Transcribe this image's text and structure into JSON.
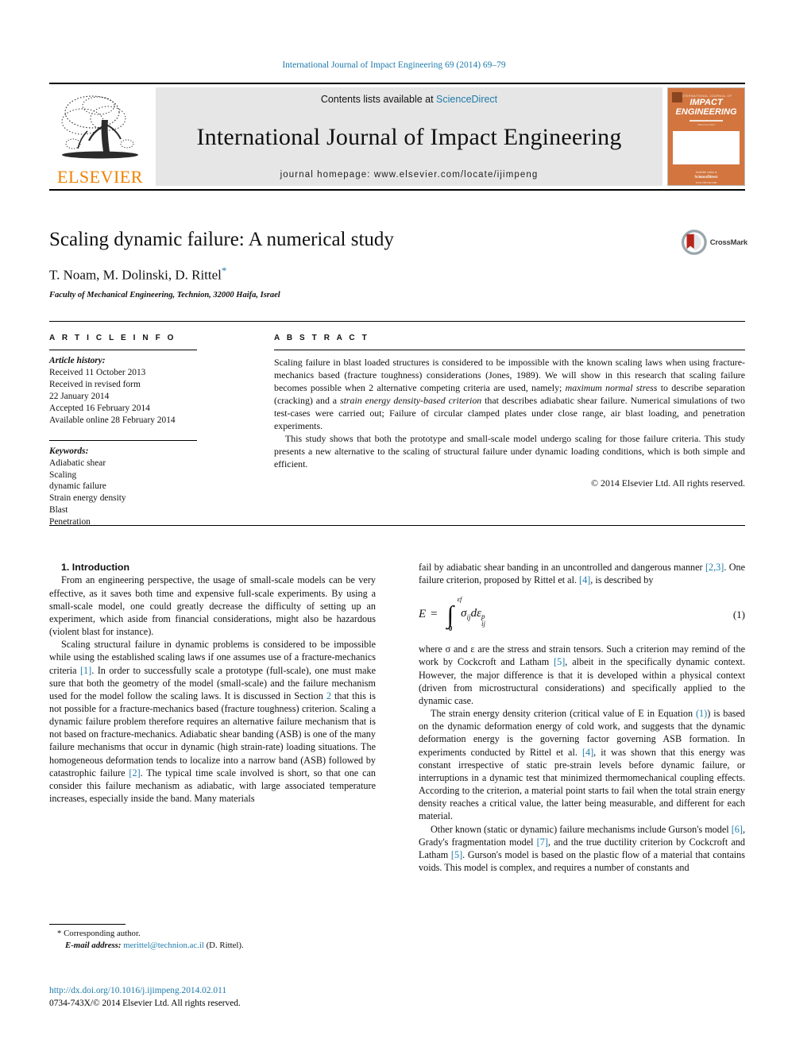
{
  "running_head": "International Journal of Impact Engineering 69 (2014) 69–79",
  "masthead": {
    "publisher": "ELSEVIER",
    "contents_prefix": "Contents lists available at ",
    "contents_link": "ScienceDirect",
    "journal_name": "International Journal of Impact Engineering",
    "homepage": "journal homepage: www.elsevier.com/locate/ijimpeng",
    "cover": {
      "publisher_line": "INTERNATIONAL JOURNAL OF",
      "title_line1": "IMPACT",
      "title_line2": "ENGINEERING",
      "subtitle": "Editor-in-Chief",
      "foot_line1": "Available online at",
      "foot_line2": "ScienceDirect",
      "foot_line3": "www.elsevier.com"
    }
  },
  "article": {
    "title": "Scaling dynamic failure: A numerical study",
    "authors": "T. Noam, M. Dolinski, D. Rittel",
    "corresponding_marker": "*",
    "affiliation": "Faculty of Mechanical Engineering, Technion, 32000 Haifa, Israel",
    "crossmark_label": "CrossMark"
  },
  "article_info": {
    "heading": "A R T I C L E   I N F O",
    "history_label": "Article history:",
    "history": [
      "Received 11 October 2013",
      "Received in revised form",
      "22 January 2014",
      "Accepted 16 February 2014",
      "Available online 28 February 2014"
    ],
    "keywords_label": "Keywords:",
    "keywords": [
      "Adiabatic shear",
      "Scaling",
      "dynamic failure",
      "Strain energy density",
      "Blast",
      "Penetration"
    ]
  },
  "abstract": {
    "heading": "A B S T R A C T",
    "paragraph1_a": "Scaling failure in blast loaded structures is considered to be impossible with the known scaling laws when using fracture-mechanics based (fracture toughness) considerations (Jones, 1989). We will show in this research that scaling failure becomes possible when 2 alternative competing criteria are used, namely; ",
    "paragraph1_i1": "maximum normal stress",
    "paragraph1_b": " to describe separation (cracking) and a ",
    "paragraph1_i2": "strain energy density-based criterion",
    "paragraph1_c": " that describes adiabatic shear failure. Numerical simulations of two test-cases were carried out; Failure of circular clamped plates under close range, air blast loading, and penetration experiments.",
    "paragraph2": "This study shows that both the prototype and small-scale model undergo scaling for those failure criteria. This study presents a new alternative to the scaling of structural failure under dynamic loading conditions, which is both simple and efficient.",
    "copyright": "© 2014 Elsevier Ltd. All rights reserved."
  },
  "body": {
    "section_title": "1. Introduction",
    "left": {
      "p1": "From an engineering perspective, the usage of small-scale models can be very effective, as it saves both time and expensive full-scale experiments. By using a small-scale model, one could greatly decrease the difficulty of setting up an experiment, which aside from financial considerations, might also be hazardous (violent blast for instance).",
      "p2_a": "Scaling structural failure in dynamic problems is considered to be impossible while using the established scaling laws if one assumes use of a fracture-mechanics criteria ",
      "p2_ref1": "[1]",
      "p2_b": ". In order to successfully scale a prototype (full-scale), one must make sure that both the geometry of the model (small-scale) and the failure mechanism used for the model follow the scaling laws. It is discussed in Section ",
      "p2_ref2": "2",
      "p2_c": " that this is not possible for a fracture-mechanics based (fracture toughness) criterion. Scaling a dynamic failure problem therefore requires an alternative failure mechanism that is not based on fracture-mechanics. Adiabatic shear banding (ASB) is one of the many failure mechanisms that occur in dynamic (high strain-rate) loading situations. The homogeneous deformation tends to localize into a narrow band (ASB) followed by catastrophic failure ",
      "p2_ref3": "[2]",
      "p2_d": ". The typical time scale involved is short, so that one can consider this failure mechanism as adiabatic, with large associated temperature increases, especially inside the band. Many materials"
    },
    "right": {
      "p1_a": "fail by adiabatic shear banding in an uncontrolled and dangerous manner ",
      "p1_ref1": "[2,3]",
      "p1_b": ". One failure criterion, proposed by Rittel et al. ",
      "p1_ref2": "[4]",
      "p1_c": ", is described by",
      "equation": {
        "lhs": "E",
        "equals": "=",
        "integral_upper": "εf",
        "integral_lower": "0",
        "integrand_stress": "σ",
        "integrand_stress_sub": "ij",
        "integrand_d": "dε",
        "integrand_sub": "ij",
        "integrand_sup": "p",
        "number": "(1)"
      },
      "p2_a": "where σ and ε are the stress and strain tensors. Such a criterion may remind of the work by Cockcroft and Latham ",
      "p2_ref1": "[5]",
      "p2_b": ", albeit in the specifically dynamic context. However, the major difference is that it is developed within a physical context (driven from microstructural considerations) and specifically applied to the dynamic case.",
      "p3_a": "The strain energy density criterion (critical value of E in Equation ",
      "p3_ref1": "(1)",
      "p3_b": ") is based on the dynamic deformation energy of cold work, and suggests that the dynamic deformation energy is the governing factor governing ASB formation. In experiments conducted by Rittel et al. ",
      "p3_ref2": "[4]",
      "p3_c": ", it was shown that this energy was constant irrespective of static pre-strain levels before dynamic failure, or interruptions in a dynamic test that minimized thermomechanical coupling effects. According to the criterion, a material point starts to fail when the total strain energy density reaches a critical value, the latter being measurable, and different for each material.",
      "p4_a": "Other known (static or dynamic) failure mechanisms include Gurson's model ",
      "p4_ref1": "[6]",
      "p4_b": ", Grady's fragmentation model ",
      "p4_ref2": "[7]",
      "p4_c": ", and the true ductility criterion by Cockcroft and Latham ",
      "p4_ref3": "[5]",
      "p4_d": ". Gurson's model is based on the plastic flow of a material that contains voids. This model is complex, and requires a number of constants and"
    }
  },
  "footnote": {
    "corresponding": "* Corresponding author.",
    "email_label": "E-mail address:",
    "email": "merittel@technion.ac.il",
    "email_owner": "(D. Rittel).",
    "doi": "http://dx.doi.org/10.1016/j.ijimpeng.2014.02.011",
    "issn_line": "0734-743X/© 2014 Elsevier Ltd. All rights reserved."
  },
  "colors": {
    "link_blue": "#1f7bab",
    "elsevier_orange": "#f08100",
    "cover_orange": "#d2753f",
    "band_gray": "#e6e6e6"
  }
}
